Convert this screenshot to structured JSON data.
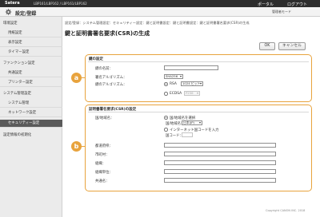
{
  "topbar": {
    "brand": "Satera",
    "model": "LBP161/LBP162 / LBP161/LBP162",
    "portal": "ポータル",
    "logout": "ログアウト"
  },
  "titlebar": {
    "title": "設定/登録",
    "mode": "管理者モード"
  },
  "sidebar": {
    "items": [
      {
        "label": "環境設定",
        "type": "section"
      },
      {
        "label": "用紙設定",
        "type": "sub"
      },
      {
        "label": "表示設定",
        "type": "sub"
      },
      {
        "label": "タイマー設定",
        "type": "sub"
      },
      {
        "label": "ファンクション設定",
        "type": "section"
      },
      {
        "label": "共通設定",
        "type": "sub"
      },
      {
        "label": "プリンター設定",
        "type": "sub"
      },
      {
        "label": "システム管理設定",
        "type": "section"
      },
      {
        "label": "システム管理",
        "type": "sub"
      },
      {
        "label": "ネットワーク設定",
        "type": "sub"
      },
      {
        "label": "セキュリティー設定",
        "type": "sub",
        "active": true
      },
      {
        "label": "設定情報の初期化",
        "type": "section"
      }
    ]
  },
  "breadcrumb": "設定/登録：システム管理設定：セキュリティー設定：鍵と証明書設定：鍵と証明書設定：鍵と証明書署名要求(CSR)の生成",
  "page_title": "鍵と証明書署名要求(CSR)の生成",
  "buttons": {
    "ok": "OK",
    "cancel": "キャンセル"
  },
  "callouts": {
    "a": "a",
    "b": "b"
  },
  "key_settings": {
    "heading": "鍵の設定",
    "key_name_label": "鍵の名前：",
    "key_name_value": "",
    "sig_algo_label": "署名アルゴリズム：",
    "sig_algo_value": "SHA256",
    "key_algo_label": "鍵のアルゴリズム：",
    "rsa_label": "RSA",
    "rsa_length": "1024 ビット",
    "ecdsa_label": "ECDSA",
    "ecdsa_curve": "P256"
  },
  "csr_settings": {
    "heading": "証明書署名要求(CSR)の設定",
    "country_label": "国/地域名：",
    "select_country_label": "国/地域名を選択",
    "country_name_label": "国/地域名：",
    "country_value": "日本(JP)",
    "internet_code_label": "インターネット国コードを入力",
    "country_code_label": "国コード：",
    "state_label": "都道府県：",
    "city_label": "市町村：",
    "org_label": "組織：",
    "unit_label": "組織単位：",
    "common_name_label": "共通名："
  },
  "footer": "Copyright CANON INC. 2018"
}
